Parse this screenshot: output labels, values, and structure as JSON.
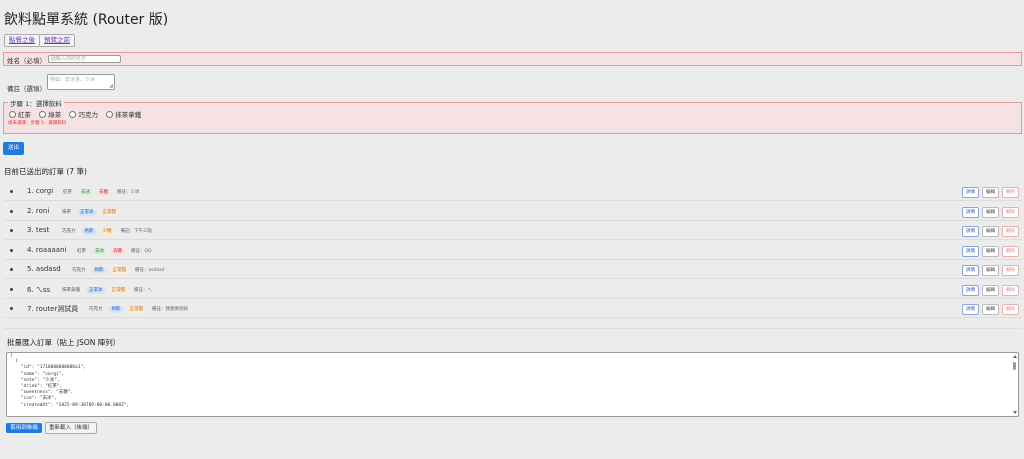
{
  "page": {
    "title": "飲料點單系統 (Router 版)"
  },
  "nav": [
    {
      "label": "點餐之後"
    },
    {
      "label": "預覽之前"
    }
  ],
  "form": {
    "name_label": "姓名（必填）",
    "name_placeholder": "請輸入你的名字",
    "note_label": "備註（選填）",
    "note_placeholder": "例如：去冰多、少冰",
    "step_label": "步驟 1：選擇飲料",
    "drink_options": [
      "紅茶",
      "綠茶",
      "巧克力",
      "抹茶拿鐵"
    ],
    "error_text": "尚未選擇：步驟 1：選擇飲料",
    "submit_label": "送出"
  },
  "orders": {
    "heading": "目前已送出的訂單 (7 筆)",
    "items": [
      {
        "label": "1. corgi",
        "drink": "紅茶",
        "sweetness": "去冰",
        "ice": "去糖",
        "note": "備註：少冰"
      },
      {
        "label": "2. roni",
        "drink": "綠茶",
        "sweetness": "正常冰",
        "ice": "正常甜",
        "note": ""
      },
      {
        "label": "3. test",
        "drink": "巧克力",
        "sweetness": "熱飲",
        "ice": "少糖",
        "note": "備註：下午三點"
      },
      {
        "label": "4. roaaaani",
        "drink": "紅茶",
        "sweetness": "去冰",
        "ice": "去糖",
        "note": "備註：QQ"
      },
      {
        "label": "5. asdasd",
        "drink": "巧克力",
        "sweetness": "熱飲",
        "ice": "正常甜",
        "note": "備註：asdasd"
      },
      {
        "label": "6. ㄟss",
        "drink": "抹茶拿鐵",
        "sweetness": "正常冰",
        "ice": "正常甜",
        "note": "備註：ㄟ"
      },
      {
        "label": "7. router測試員",
        "drink": "巧克力",
        "sweetness": "熱飲",
        "ice": "正常甜",
        "note": "備註：我想要測試"
      }
    ],
    "actions": {
      "detail": "詳情",
      "edit": "編輯",
      "delete": "刪除"
    }
  },
  "import": {
    "heading": "批量匯入訂單（貼上 JSON 陣列）",
    "json_lines": [
      "[",
      "  {",
      "    \"id\": \"1710000000000a1\",",
      "    \"name\": \"corgi\",",
      "    \"note\": \"少冰\",",
      "    \"drink\": \"紅茶\",",
      "    \"sweetness\": \"去糖\",",
      "    \"ice\": \"去冰\",",
      "    \"createdAt\": \"2025-09-30T09:00:00.000Z\","
    ],
    "apply_label": "套用到後端",
    "reload_label": "重新載入（後端）"
  },
  "colors": {
    "primary": "#1f7ae0",
    "error_border": "#e59a9a",
    "error_bg": "#f6e2e2"
  }
}
